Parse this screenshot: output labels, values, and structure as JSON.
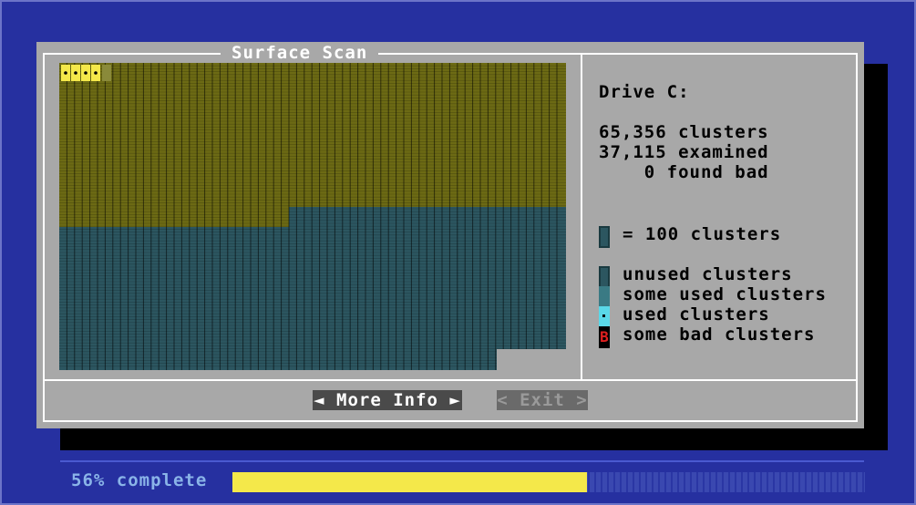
{
  "dialog": {
    "title": "Surface Scan",
    "drive_label": "Drive C:",
    "stats": {
      "clusters": "65,356 clusters",
      "examined": "37,115 examined",
      "found_bad": "    0 found bad"
    },
    "scale_text": "= 100 clusters",
    "legend": [
      {
        "label": "unused clusters",
        "kind": "unused"
      },
      {
        "label": "some used clusters",
        "kind": "some-used"
      },
      {
        "label": "used clusters",
        "kind": "used"
      },
      {
        "label": "some bad clusters",
        "kind": "bad",
        "glyph": "B"
      }
    ],
    "buttons": {
      "more_info": "◄ More Info ►",
      "exit": "< Exit >"
    }
  },
  "progress": {
    "label": "56% complete",
    "percent": 56
  },
  "colors": {
    "background": "#2630a0",
    "dialog": "#a8a8a8",
    "scanned": "#6c6a14",
    "unscanned": "#2c5660",
    "used": "#f4e84a",
    "bad": "#d02020",
    "progress_fill": "#f4e84a"
  }
}
